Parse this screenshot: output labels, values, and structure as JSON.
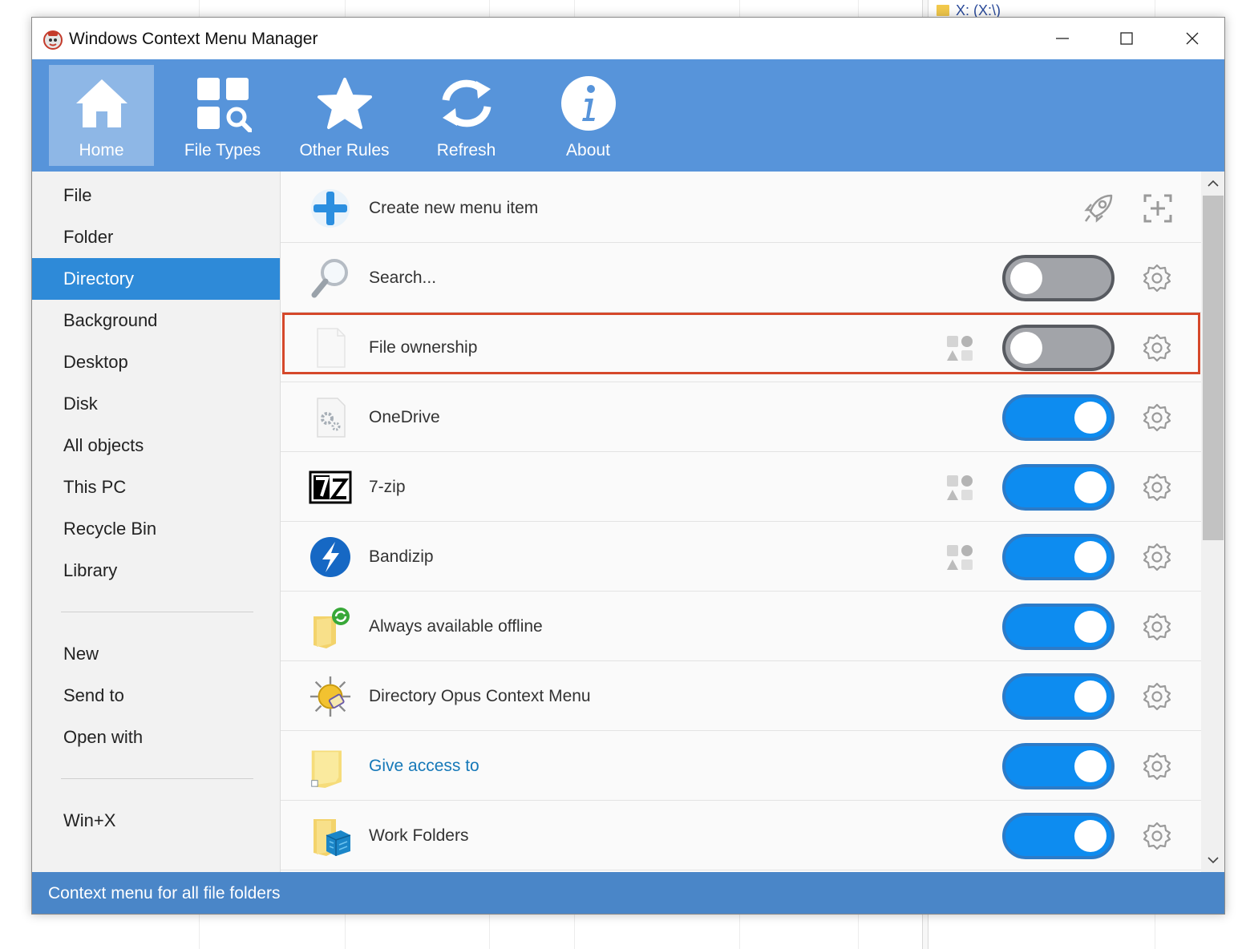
{
  "window": {
    "title": "Windows Context Menu Manager"
  },
  "background": {
    "drive_label": "X: (X:\\)"
  },
  "toolbar": {
    "buttons": [
      {
        "label": "Home",
        "icon": "home-icon",
        "active": true
      },
      {
        "label": "File Types",
        "icon": "file-types-icon",
        "active": false
      },
      {
        "label": "Other Rules",
        "icon": "star-icon",
        "active": false
      },
      {
        "label": "Refresh",
        "icon": "refresh-icon",
        "active": false
      },
      {
        "label": "About",
        "icon": "info-icon",
        "active": false
      }
    ]
  },
  "sidebar": {
    "items": [
      {
        "label": "File"
      },
      {
        "label": "Folder"
      },
      {
        "label": "Directory",
        "selected": true
      },
      {
        "label": "Background"
      },
      {
        "label": "Desktop"
      },
      {
        "label": "Disk"
      },
      {
        "label": "All objects"
      },
      {
        "label": "This PC"
      },
      {
        "label": "Recycle Bin"
      },
      {
        "label": "Library"
      },
      {
        "label": "New"
      },
      {
        "label": "Send to"
      },
      {
        "label": "Open with"
      },
      {
        "label": "Win+X"
      }
    ]
  },
  "list": {
    "items": [
      {
        "label": "Create new menu item",
        "icon": "plus-icon",
        "toggle": null
      },
      {
        "label": "Search...",
        "icon": "magnifier-icon",
        "toggle": "off"
      },
      {
        "label": "File ownership",
        "icon": "blank-file-icon",
        "toggle": "off",
        "shell_ext": true,
        "highlighted": true
      },
      {
        "label": "OneDrive",
        "icon": "gear-file-icon",
        "toggle": "on"
      },
      {
        "label": "7-zip",
        "icon": "7zip-icon",
        "toggle": "on",
        "shell_ext": true
      },
      {
        "label": "Bandizip",
        "icon": "bandizip-icon",
        "toggle": "on",
        "shell_ext": true
      },
      {
        "label": "Always available offline",
        "icon": "sync-folder-icon",
        "toggle": "on"
      },
      {
        "label": "Directory Opus Context Menu",
        "icon": "directory-opus-icon",
        "toggle": "on"
      },
      {
        "label": "Give access to",
        "icon": "share-folder-icon",
        "toggle": "on",
        "link": true
      },
      {
        "label": "Work Folders",
        "icon": "work-folders-icon",
        "toggle": "on"
      }
    ]
  },
  "statusbar": {
    "text": "Context menu for all file folders"
  },
  "colors": {
    "toolbar": "#5794da",
    "selected": "#2e8ad8",
    "toggle_on": "#0d8cf0",
    "toggle_off": "#a2a4a9",
    "highlight": "#d5482b",
    "statusbar": "#4a86c8"
  }
}
